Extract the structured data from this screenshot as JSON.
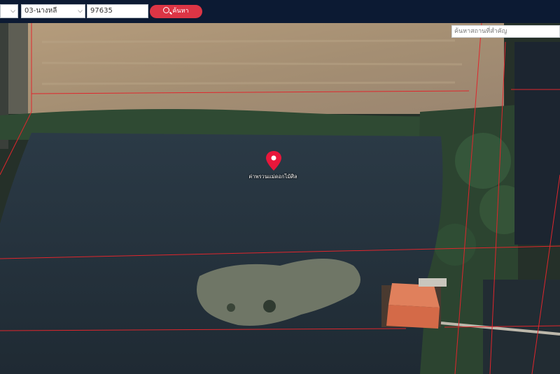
{
  "toolbar": {
    "province_select_value": "",
    "district_select_value": "03-นางหลี",
    "parcel_input_value": "97635",
    "search_button_label": "ค้นหา"
  },
  "map": {
    "place_search_placeholder": "ค้นหาสถานที่สำคัญ",
    "pin_label": "ค่าพรวนแม่ดอกไม้ศิล",
    "pin_color": "#e8173b"
  },
  "colors": {
    "toolbar_bg": "#0c1a33",
    "search_button": "#dc3545",
    "parcel_lines": "#e0262c"
  }
}
